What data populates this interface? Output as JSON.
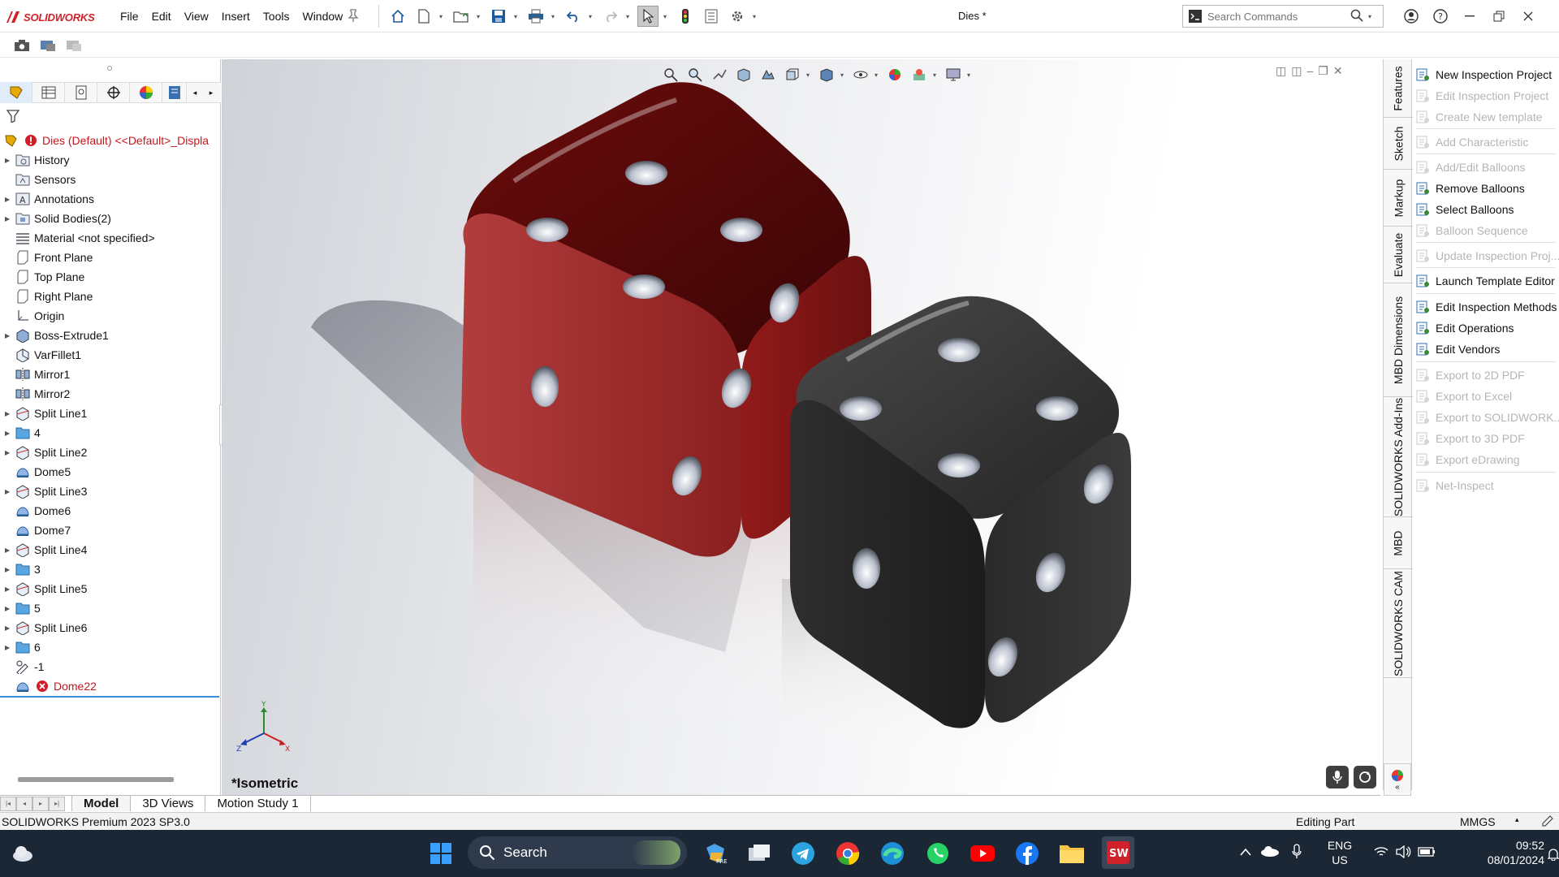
{
  "app": {
    "logo_text": "SOLIDWORKS",
    "doc_title": "Dies *"
  },
  "menu": [
    "File",
    "Edit",
    "View",
    "Insert",
    "Tools",
    "Window"
  ],
  "search": {
    "placeholder": "Search Commands"
  },
  "feature_tree": {
    "root": "Dies (Default) <<Default>_Displa",
    "items": [
      {
        "label": "History",
        "arrow": true,
        "icon": "history-folder-icon"
      },
      {
        "label": "Sensors",
        "arrow": false,
        "icon": "sensors-icon"
      },
      {
        "label": "Annotations",
        "arrow": true,
        "icon": "annotations-icon"
      },
      {
        "label": "Solid Bodies(2)",
        "arrow": true,
        "icon": "solid-bodies-icon"
      },
      {
        "label": "Material <not specified>",
        "arrow": false,
        "icon": "material-icon"
      },
      {
        "label": "Front Plane",
        "arrow": false,
        "icon": "plane-icon"
      },
      {
        "label": "Top Plane",
        "arrow": false,
        "icon": "plane-icon"
      },
      {
        "label": "Right Plane",
        "arrow": false,
        "icon": "plane-icon"
      },
      {
        "label": "Origin",
        "arrow": false,
        "icon": "origin-icon"
      },
      {
        "label": "Boss-Extrude1",
        "arrow": true,
        "icon": "extrude-icon"
      },
      {
        "label": "VarFillet1",
        "arrow": false,
        "icon": "fillet-icon"
      },
      {
        "label": "Mirror1",
        "arrow": false,
        "icon": "mirror-icon"
      },
      {
        "label": "Mirror2",
        "arrow": false,
        "icon": "mirror-icon"
      },
      {
        "label": "Split Line1",
        "arrow": true,
        "icon": "split-line-icon"
      },
      {
        "label": "4",
        "arrow": true,
        "icon": "folder-icon"
      },
      {
        "label": "Split Line2",
        "arrow": true,
        "icon": "split-line-icon"
      },
      {
        "label": "Dome5",
        "arrow": false,
        "icon": "dome-icon"
      },
      {
        "label": "Split Line3",
        "arrow": true,
        "icon": "split-line-icon"
      },
      {
        "label": "Dome6",
        "arrow": false,
        "icon": "dome-icon"
      },
      {
        "label": "Dome7",
        "arrow": false,
        "icon": "dome-icon"
      },
      {
        "label": "Split Line4",
        "arrow": true,
        "icon": "split-line-icon"
      },
      {
        "label": "3",
        "arrow": true,
        "icon": "folder-icon"
      },
      {
        "label": "Split Line5",
        "arrow": true,
        "icon": "split-line-icon"
      },
      {
        "label": "5",
        "arrow": true,
        "icon": "folder-icon"
      },
      {
        "label": "Split Line6",
        "arrow": true,
        "icon": "split-line-icon"
      },
      {
        "label": "6",
        "arrow": true,
        "icon": "folder-icon"
      },
      {
        "label": "-1",
        "arrow": false,
        "icon": "sketch-icon"
      },
      {
        "label": "Dome22",
        "arrow": false,
        "icon": "error-icon",
        "error": true
      }
    ]
  },
  "viewport": {
    "view_label": "*Isometric",
    "axes": {
      "x": "X",
      "y": "Y",
      "z": "Z"
    }
  },
  "bottom_tabs": [
    "Model",
    "3D Views",
    "Motion Study 1"
  ],
  "status": {
    "left": "SOLIDWORKS Premium 2023 SP3.0",
    "mode": "Editing Part",
    "units": "MMGS"
  },
  "right_tabs": [
    "Features",
    "Sketch",
    "Markup",
    "Evaluate",
    "MBD Dimensions",
    "SOLIDWORKS Add-Ins",
    "MBD",
    "SOLIDWORKS CAM"
  ],
  "task_pane": {
    "items": [
      {
        "label": "New Inspection Project",
        "enabled": true
      },
      {
        "label": "Edit Inspection Project",
        "enabled": false
      },
      {
        "label": "Create New template",
        "enabled": false
      },
      {
        "label": "Add Characteristic",
        "enabled": false
      },
      {
        "label": "Add/Edit Balloons",
        "enabled": false
      },
      {
        "label": "Remove Balloons",
        "enabled": true
      },
      {
        "label": "Select Balloons",
        "enabled": true
      },
      {
        "label": "Balloon Sequence",
        "enabled": false
      },
      {
        "label": "Update Inspection Proj...",
        "enabled": false
      },
      {
        "label": "Launch Template Editor",
        "enabled": true
      },
      {
        "label": "Edit Inspection Methods",
        "enabled": true
      },
      {
        "label": "Edit Operations",
        "enabled": true
      },
      {
        "label": "Edit Vendors",
        "enabled": true
      },
      {
        "label": "Export to 2D PDF",
        "enabled": false
      },
      {
        "label": "Export to Excel",
        "enabled": false
      },
      {
        "label": "Export to SOLIDWORK...",
        "enabled": false
      },
      {
        "label": "Export to 3D PDF",
        "enabled": false
      },
      {
        "label": "Export eDrawing",
        "enabled": false
      },
      {
        "label": "Net-Inspect",
        "enabled": false
      }
    ]
  },
  "taskbar": {
    "search_label": "Search",
    "lang_top": "ENG",
    "lang_bottom": "US",
    "time": "09:52",
    "date": "08/01/2024"
  },
  "colors": {
    "red_die": "#8b1010",
    "black_die": "#1e1e1e",
    "accent": "#3b8dd6",
    "error": "#c8161e"
  }
}
